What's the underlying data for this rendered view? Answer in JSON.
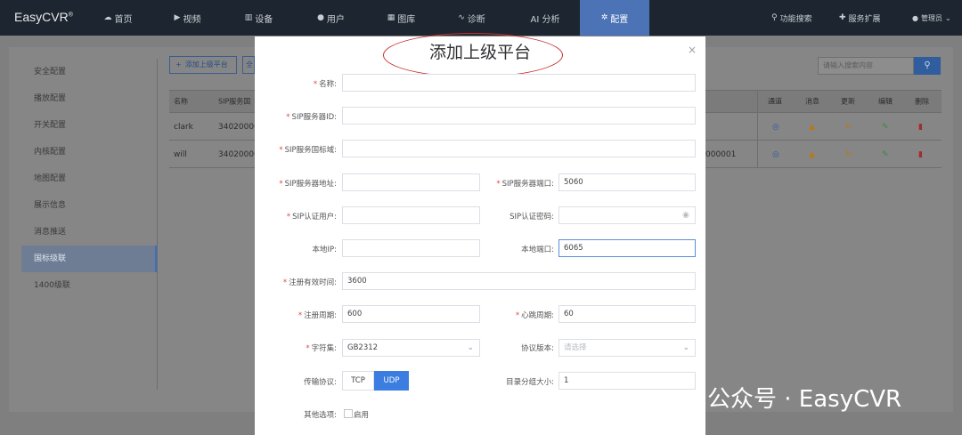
{
  "app": {
    "title": "EasyCVR",
    "trademark": "®"
  },
  "nav": [
    {
      "label": "首页",
      "icon": "cloud-icon"
    },
    {
      "label": "视频",
      "icon": "play-icon"
    },
    {
      "label": "设备",
      "icon": "device-icon"
    },
    {
      "label": "用户",
      "icon": "user-icon"
    },
    {
      "label": "图库",
      "icon": "gallery-icon"
    },
    {
      "label": "诊断",
      "icon": "pulse-icon"
    },
    {
      "label": "AI 分析",
      "icon": ""
    },
    {
      "label": "配置",
      "icon": "gear-icon",
      "active": true
    }
  ],
  "right_nav": {
    "search": "功能搜索",
    "extend": "服务扩展",
    "user": "管理员"
  },
  "sidebar": {
    "items": [
      "安全配置",
      "播放配置",
      "开关配置",
      "内核配置",
      "地图配置",
      "展示信息",
      "消息推送",
      "国标级联",
      "1400级联"
    ],
    "active_index": 7
  },
  "toolbar": {
    "add_label": "添加上级平台",
    "add2_label": "全",
    "search_placeholder": "请输入搜索内容"
  },
  "table": {
    "headers": [
      "名称",
      "SIP服务国"
    ],
    "op_headers": [
      "通道",
      "消息",
      "更新",
      "编辑",
      "删除"
    ],
    "rows": [
      {
        "name": "clark",
        "sip": "34020000",
        "extra": ""
      },
      {
        "name": "will",
        "sip": "34020000",
        "extra": "000001"
      }
    ]
  },
  "modal": {
    "title": "添加上级平台",
    "fields": {
      "name": {
        "label": "名称:",
        "value": ""
      },
      "sip_id": {
        "label": "SIP服务器ID:",
        "value": ""
      },
      "sip_domain": {
        "label": "SIP服务国标域:",
        "value": ""
      },
      "sip_addr": {
        "label": "SIP服务器地址:",
        "value": ""
      },
      "sip_port": {
        "label": "SIP服务器端口:",
        "value": "5060"
      },
      "sip_user": {
        "label": "SIP认证用户:",
        "value": ""
      },
      "sip_pwd": {
        "label": "SIP认证密码:",
        "value": ""
      },
      "local_ip": {
        "label": "本地IP:",
        "value": ""
      },
      "local_port": {
        "label": "本地端口:",
        "value": "6065"
      },
      "reg_valid": {
        "label": "注册有效时间:",
        "value": "3600"
      },
      "reg_period": {
        "label": "注册周期:",
        "value": "600"
      },
      "heartbeat": {
        "label": "心跳周期:",
        "value": "60"
      },
      "charset": {
        "label": "字符集:",
        "value": "GB2312"
      },
      "protocol_ver": {
        "label": "协议版本:",
        "placeholder": "请选择"
      },
      "transport": {
        "label": "传输协议:",
        "options": [
          "TCP",
          "UDP"
        ],
        "selected": "UDP"
      },
      "catalog_size": {
        "label": "目录分组大小:",
        "value": "1"
      },
      "other": {
        "label": "其他选项:",
        "checkbox_label": "启用"
      }
    }
  },
  "watermark": {
    "text": "公众号 · EasyCVR"
  }
}
